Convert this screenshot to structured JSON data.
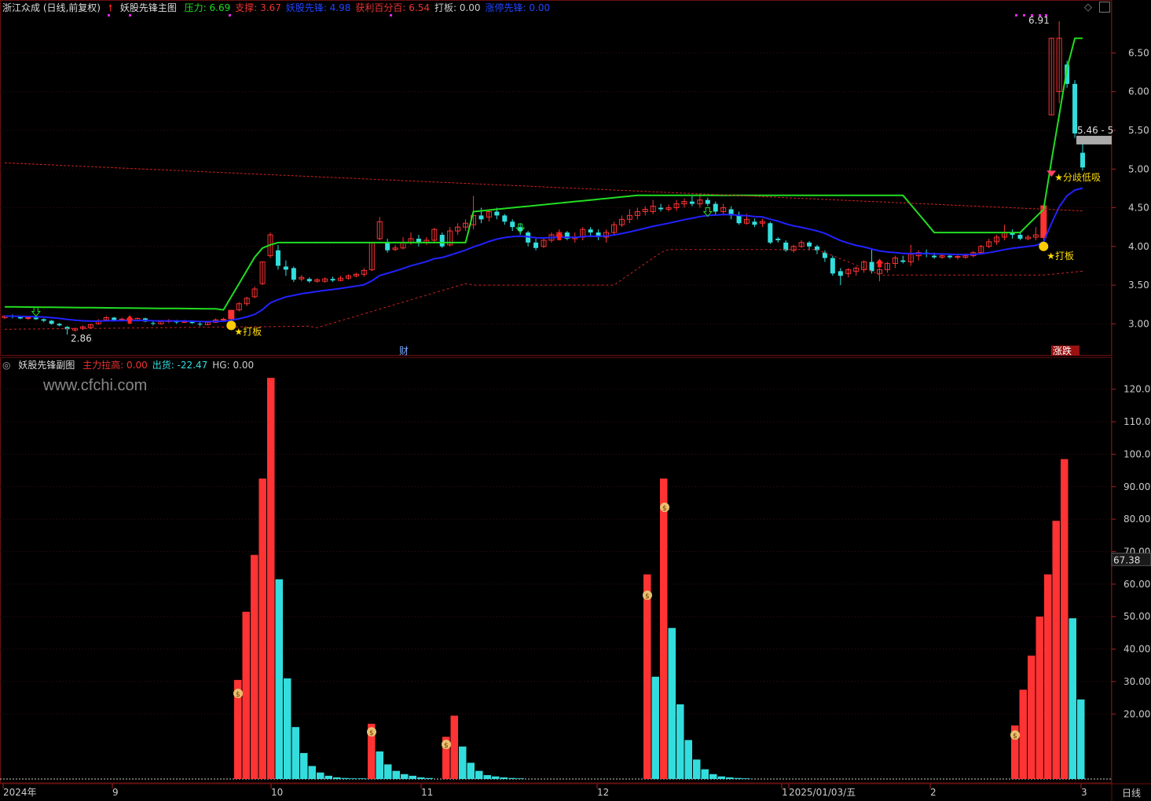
{
  "main_header": {
    "stock": "浙江众成 (日线,前复权)",
    "indicator": "妖股先锋主图",
    "items": [
      {
        "text": "压力: 6.69",
        "color": "#22dd22"
      },
      {
        "text": "支撑: 3.67",
        "color": "#ee3333"
      },
      {
        "text": "妖股先锋: 4.98",
        "color": "#2244ff"
      },
      {
        "text": "获利百分百: 6.54",
        "color": "#ee3333"
      },
      {
        "text": "打板: 0.00",
        "color": "#cccccc"
      },
      {
        "text": "涨停先锋: 0.00",
        "color": "#2244ff"
      }
    ]
  },
  "sub_header": {
    "indicator": "妖股先锋副图",
    "items": [
      {
        "text": "主力拉高: 0.00",
        "color": "#ee3333"
      },
      {
        "text": "出货: -22.47",
        "color": "#33dddd"
      },
      {
        "text": "HG: 0.00",
        "color": "#cccccc"
      }
    ]
  },
  "watermark": "www.cfchi.com",
  "price_axis": [
    "6.50",
    "6.00",
    "5.50",
    "5.00",
    "4.50",
    "4.00",
    "3.50",
    "3.00"
  ],
  "sub_axis": [
    "120.0",
    "110.0",
    "100.0",
    "90.00",
    "80.00",
    "70.00",
    "60.00",
    "50.00",
    "40.00",
    "30.00",
    "20.00"
  ],
  "sub_axis_marker": "67.38",
  "date_axis": [
    "2024年",
    "9",
    "10",
    "11",
    "12",
    "1",
    "2025/01/03/五",
    "2",
    "3"
  ],
  "period_label": "日线",
  "annotations": {
    "low_price": "2.86",
    "high_price": "6.91",
    "last_price": "5.46 - 5",
    "signal_daban": "★打板",
    "signal_fenqi": "★分歧低吸",
    "cai_marker": "财",
    "zhangtingdie_marker": "涨跌"
  },
  "colors": {
    "up": "#ff3333",
    "down": "#33dddd",
    "resistance": "#22dd22",
    "trend": "#2222ff",
    "support": "#cc2222"
  },
  "chart_data": {
    "type": "candlestick",
    "price_ylim": [
      2.75,
      6.9
    ],
    "candles": [
      [
        3.08,
        3.1,
        3.06,
        3.11,
        0
      ],
      [
        3.1,
        3.09,
        3.07,
        3.12,
        0
      ],
      [
        3.09,
        3.07,
        3.06,
        3.1,
        0
      ],
      [
        3.07,
        3.08,
        3.05,
        3.1,
        0
      ],
      [
        3.08,
        3.06,
        3.05,
        3.09,
        0
      ],
      [
        3.06,
        3.04,
        3.02,
        3.07,
        0
      ],
      [
        3.04,
        3.0,
        2.99,
        3.05,
        0
      ],
      [
        3.0,
        2.98,
        2.97,
        3.01,
        0
      ],
      [
        2.96,
        2.93,
        2.86,
        2.97,
        0
      ],
      [
        2.92,
        2.94,
        2.9,
        2.95,
        0
      ],
      [
        2.94,
        2.96,
        2.92,
        2.98,
        0
      ],
      [
        2.95,
        2.99,
        2.94,
        3.0,
        0
      ],
      [
        3.0,
        3.04,
        2.99,
        3.06,
        0
      ],
      [
        3.05,
        3.08,
        3.03,
        3.1,
        0
      ],
      [
        3.08,
        3.05,
        3.03,
        3.09,
        0
      ],
      [
        3.05,
        3.06,
        3.04,
        3.08,
        0
      ],
      [
        3.05,
        3.04,
        3.02,
        3.07,
        0
      ],
      [
        3.04,
        3.07,
        3.03,
        3.08,
        0
      ],
      [
        3.07,
        3.03,
        3.02,
        3.08,
        0
      ],
      [
        3.01,
        3.0,
        2.98,
        3.03,
        0
      ],
      [
        3.0,
        3.03,
        2.99,
        3.04,
        0
      ],
      [
        3.03,
        3.04,
        3.01,
        3.06,
        0
      ],
      [
        3.04,
        3.02,
        3.0,
        3.05,
        0
      ],
      [
        3.02,
        3.03,
        3.01,
        3.05,
        0
      ],
      [
        3.03,
        3.01,
        3.0,
        3.04,
        0
      ],
      [
        3.0,
        2.99,
        2.97,
        3.02,
        0
      ],
      [
        2.99,
        3.02,
        2.98,
        3.03,
        0
      ],
      [
        3.02,
        3.05,
        3.01,
        3.07,
        0
      ],
      [
        3.05,
        3.06,
        3.03,
        3.08,
        0
      ],
      [
        3.06,
        3.18,
        3.05,
        3.18,
        1
      ],
      [
        3.18,
        3.26,
        3.16,
        3.28,
        0
      ],
      [
        3.26,
        3.33,
        3.23,
        3.35,
        0
      ],
      [
        3.35,
        3.45,
        3.33,
        3.48,
        0
      ],
      [
        3.52,
        3.8,
        3.5,
        3.8,
        0
      ],
      [
        3.88,
        4.15,
        3.85,
        4.18,
        0
      ],
      [
        3.95,
        3.75,
        3.7,
        4.02,
        0
      ],
      [
        3.74,
        3.7,
        3.62,
        3.82,
        0
      ],
      [
        3.72,
        3.57,
        3.54,
        3.74,
        0
      ],
      [
        3.58,
        3.6,
        3.55,
        3.63,
        0
      ],
      [
        3.58,
        3.55,
        3.53,
        3.6,
        0
      ],
      [
        3.55,
        3.57,
        3.53,
        3.59,
        0
      ],
      [
        3.55,
        3.58,
        3.53,
        3.6,
        0
      ],
      [
        3.58,
        3.56,
        3.54,
        3.61,
        0
      ],
      [
        3.56,
        3.59,
        3.55,
        3.62,
        0
      ],
      [
        3.59,
        3.62,
        3.57,
        3.64,
        0
      ],
      [
        3.62,
        3.64,
        3.6,
        3.66,
        0
      ],
      [
        3.64,
        3.69,
        3.61,
        3.72,
        0
      ],
      [
        3.7,
        4.05,
        3.68,
        4.05,
        0
      ],
      [
        4.1,
        4.32,
        4.08,
        4.38,
        0
      ],
      [
        4.05,
        3.95,
        3.92,
        4.1,
        0
      ],
      [
        3.96,
        3.98,
        3.94,
        4.02,
        0
      ],
      [
        3.98,
        4.05,
        3.96,
        4.12,
        0
      ],
      [
        4.05,
        4.1,
        4.02,
        4.18,
        0
      ],
      [
        4.1,
        4.05,
        4.0,
        4.15,
        0
      ],
      [
        4.05,
        4.08,
        4.02,
        4.12,
        0
      ],
      [
        4.08,
        4.22,
        4.05,
        4.24,
        0
      ],
      [
        4.15,
        4.0,
        3.98,
        4.18,
        0
      ],
      [
        4.02,
        4.2,
        4.0,
        4.25,
        0
      ],
      [
        4.2,
        4.25,
        4.15,
        4.3,
        0
      ],
      [
        4.25,
        4.3,
        4.2,
        4.35,
        0
      ],
      [
        4.28,
        4.4,
        4.22,
        4.65,
        0
      ],
      [
        4.4,
        4.35,
        4.3,
        4.5,
        0
      ],
      [
        4.38,
        4.45,
        4.32,
        4.48,
        0
      ],
      [
        4.45,
        4.4,
        4.35,
        4.5,
        0
      ],
      [
        4.4,
        4.32,
        4.28,
        4.42,
        0
      ],
      [
        4.32,
        4.25,
        4.2,
        4.35,
        0
      ],
      [
        4.25,
        4.2,
        4.15,
        4.3,
        0
      ],
      [
        4.18,
        4.05,
        4.0,
        4.2,
        0
      ],
      [
        4.05,
        3.98,
        3.95,
        4.1,
        0
      ],
      [
        4.0,
        4.08,
        3.98,
        4.12,
        0
      ],
      [
        4.08,
        4.15,
        4.05,
        4.18,
        0
      ],
      [
        4.15,
        4.18,
        4.1,
        4.22,
        0
      ],
      [
        4.18,
        4.1,
        4.08,
        4.2,
        0
      ],
      [
        4.1,
        4.12,
        4.05,
        4.18,
        0
      ],
      [
        4.12,
        4.22,
        4.08,
        4.25,
        0
      ],
      [
        4.22,
        4.18,
        4.12,
        4.25,
        0
      ],
      [
        4.18,
        4.12,
        4.08,
        4.22,
        0
      ],
      [
        4.12,
        4.18,
        4.05,
        4.22,
        0
      ],
      [
        4.18,
        4.28,
        4.15,
        4.32,
        0
      ],
      [
        4.28,
        4.35,
        4.25,
        4.4,
        0
      ],
      [
        4.35,
        4.4,
        4.3,
        4.48,
        0
      ],
      [
        4.4,
        4.45,
        4.35,
        4.5,
        0
      ],
      [
        4.45,
        4.48,
        4.4,
        4.52,
        0
      ],
      [
        4.45,
        4.52,
        4.42,
        4.6,
        0
      ],
      [
        4.5,
        4.48,
        4.45,
        4.55,
        0
      ],
      [
        4.48,
        4.5,
        4.45,
        4.54,
        0
      ],
      [
        4.5,
        4.55,
        4.46,
        4.6,
        0
      ],
      [
        4.55,
        4.58,
        4.5,
        4.62,
        0
      ],
      [
        4.58,
        4.55,
        4.52,
        4.65,
        0
      ],
      [
        4.55,
        4.6,
        4.5,
        4.68,
        0
      ],
      [
        4.6,
        4.55,
        4.52,
        4.63,
        0
      ],
      [
        4.55,
        4.45,
        4.4,
        4.58,
        0
      ],
      [
        4.45,
        4.5,
        4.4,
        4.55,
        0
      ],
      [
        4.48,
        4.4,
        4.35,
        4.52,
        0
      ],
      [
        4.4,
        4.3,
        4.28,
        4.45,
        0
      ],
      [
        4.3,
        4.35,
        4.28,
        4.42,
        0
      ],
      [
        4.32,
        4.28,
        4.25,
        4.36,
        0
      ],
      [
        4.3,
        4.32,
        4.25,
        4.36,
        0
      ],
      [
        4.3,
        4.05,
        4.03,
        4.32,
        0
      ],
      [
        4.1,
        4.08,
        4.05,
        4.12,
        0
      ],
      [
        4.05,
        3.95,
        3.93,
        4.08,
        0
      ],
      [
        3.95,
        4.0,
        3.92,
        4.02,
        0
      ],
      [
        4.0,
        4.05,
        3.98,
        4.08,
        0
      ],
      [
        4.05,
        4.0,
        3.95,
        4.07,
        0
      ],
      [
        4.0,
        3.95,
        3.9,
        4.02,
        0
      ],
      [
        3.92,
        3.85,
        3.8,
        3.95,
        0
      ],
      [
        3.85,
        3.65,
        3.62,
        3.88,
        0
      ],
      [
        3.68,
        3.62,
        3.5,
        3.72,
        0
      ],
      [
        3.65,
        3.7,
        3.6,
        3.72,
        0
      ],
      [
        3.68,
        3.72,
        3.62,
        3.74,
        0
      ],
      [
        3.7,
        3.8,
        3.66,
        3.82,
        0
      ],
      [
        3.8,
        3.68,
        3.65,
        3.97,
        0
      ],
      [
        3.65,
        3.7,
        3.55,
        3.72,
        0
      ],
      [
        3.7,
        3.78,
        3.66,
        3.8,
        0
      ],
      [
        3.78,
        3.85,
        3.72,
        3.88,
        0
      ],
      [
        3.82,
        3.8,
        3.78,
        3.88,
        0
      ],
      [
        3.8,
        3.9,
        3.75,
        4.02,
        0
      ],
      [
        3.88,
        3.92,
        3.82,
        3.95,
        0
      ],
      [
        3.92,
        3.9,
        3.86,
        3.96,
        0
      ],
      [
        3.88,
        3.86,
        3.84,
        3.92,
        0
      ],
      [
        3.86,
        3.88,
        3.84,
        3.9,
        0
      ],
      [
        3.88,
        3.86,
        3.84,
        3.9,
        0
      ],
      [
        3.86,
        3.87,
        3.83,
        3.89,
        0
      ],
      [
        3.86,
        3.88,
        3.84,
        3.91,
        0
      ],
      [
        3.88,
        3.92,
        3.86,
        3.94,
        0
      ],
      [
        3.92,
        4.0,
        3.9,
        4.02,
        0
      ],
      [
        4.0,
        4.06,
        3.98,
        4.1,
        0
      ],
      [
        4.06,
        4.12,
        4.02,
        4.15,
        0
      ],
      [
        4.12,
        4.18,
        4.08,
        4.28,
        0
      ],
      [
        4.18,
        4.15,
        4.1,
        4.22,
        0
      ],
      [
        4.15,
        4.1,
        4.08,
        4.18,
        0
      ],
      [
        4.1,
        4.12,
        4.08,
        4.15,
        0
      ],
      [
        4.12,
        4.15,
        4.08,
        4.25,
        0
      ],
      [
        4.11,
        4.53,
        4.08,
        4.53,
        1
      ],
      [
        5.7,
        6.69,
        5.7,
        6.69,
        0
      ],
      [
        6.0,
        6.69,
        5.85,
        6.91,
        0
      ],
      [
        6.35,
        6.1,
        6.05,
        6.4,
        0
      ],
      [
        6.1,
        5.46,
        5.4,
        6.15,
        0
      ],
      [
        5.21,
        5.02,
        4.98,
        5.33,
        0
      ]
    ],
    "sub_bars": [
      [
        30.5,
        1
      ],
      [
        51.5,
        1
      ],
      [
        69.0,
        1
      ],
      [
        92.5,
        1
      ],
      [
        123.5,
        1
      ],
      [
        61.5,
        0
      ],
      [
        31.0,
        0
      ],
      [
        16.0,
        0
      ],
      [
        8.0,
        0
      ],
      [
        4.0,
        0
      ],
      [
        2.0,
        0
      ],
      [
        1.0,
        0
      ],
      [
        0.5,
        0
      ],
      [
        0.3,
        0
      ],
      [
        0.2,
        0
      ],
      [
        0.2,
        0
      ],
      [
        0.1,
        0
      ],
      [
        0.1,
        0
      ],
      [
        17.0,
        1
      ],
      [
        8.5,
        0
      ],
      [
        4.5,
        0
      ],
      [
        2.5,
        0
      ],
      [
        1.5,
        0
      ],
      [
        1.0,
        0
      ],
      [
        0.5,
        0
      ],
      [
        0.3,
        0
      ],
      [
        13.0,
        1
      ],
      [
        19.5,
        1
      ],
      [
        10.0,
        0
      ],
      [
        5.0,
        0
      ],
      [
        2.5,
        0
      ],
      [
        1.2,
        0
      ],
      [
        0.8,
        0
      ],
      [
        0.5,
        0
      ],
      [
        0.3,
        0
      ],
      [
        0.2,
        0
      ],
      [
        63.0,
        1
      ],
      [
        31.5,
        0
      ],
      [
        92.5,
        1
      ],
      [
        46.5,
        0
      ],
      [
        23.0,
        0
      ],
      [
        12.0,
        0
      ],
      [
        6.0,
        0
      ],
      [
        3.0,
        0
      ],
      [
        1.5,
        0
      ],
      [
        0.8,
        0
      ],
      [
        0.5,
        0
      ],
      [
        0.3,
        0
      ],
      [
        0.2,
        0
      ],
      [
        16.5,
        1
      ],
      [
        27.5,
        1
      ],
      [
        38.0,
        1
      ],
      [
        50.0,
        1
      ],
      [
        63.0,
        1
      ],
      [
        79.5,
        1
      ],
      [
        98.5,
        1
      ],
      [
        49.5,
        0
      ],
      [
        24.5,
        0
      ]
    ],
    "sub_ylim": [
      0,
      125
    ]
  }
}
